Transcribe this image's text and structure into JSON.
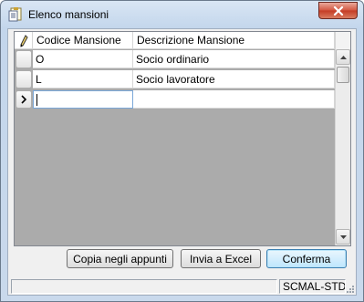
{
  "window": {
    "title": "Elenco mansioni",
    "icon": "notepad-icon",
    "close_icon": "close-icon"
  },
  "grid": {
    "header_icon": "pencil-icon",
    "columns": [
      "Codice Mansione",
      "Descrizione Mansione"
    ],
    "rows": [
      {
        "code": "O",
        "description": "Socio ordinario"
      },
      {
        "code": "L",
        "description": "Socio lavoratore"
      }
    ],
    "new_row": {
      "code": "",
      "description": ""
    },
    "current_row_marker": "current-row-arrow-icon"
  },
  "buttons": {
    "copy": "Copia negli appunti",
    "excel": "Invia a Excel",
    "confirm": "Conferma"
  },
  "statusbar": {
    "left": "",
    "right": "SCMAL-STD"
  }
}
